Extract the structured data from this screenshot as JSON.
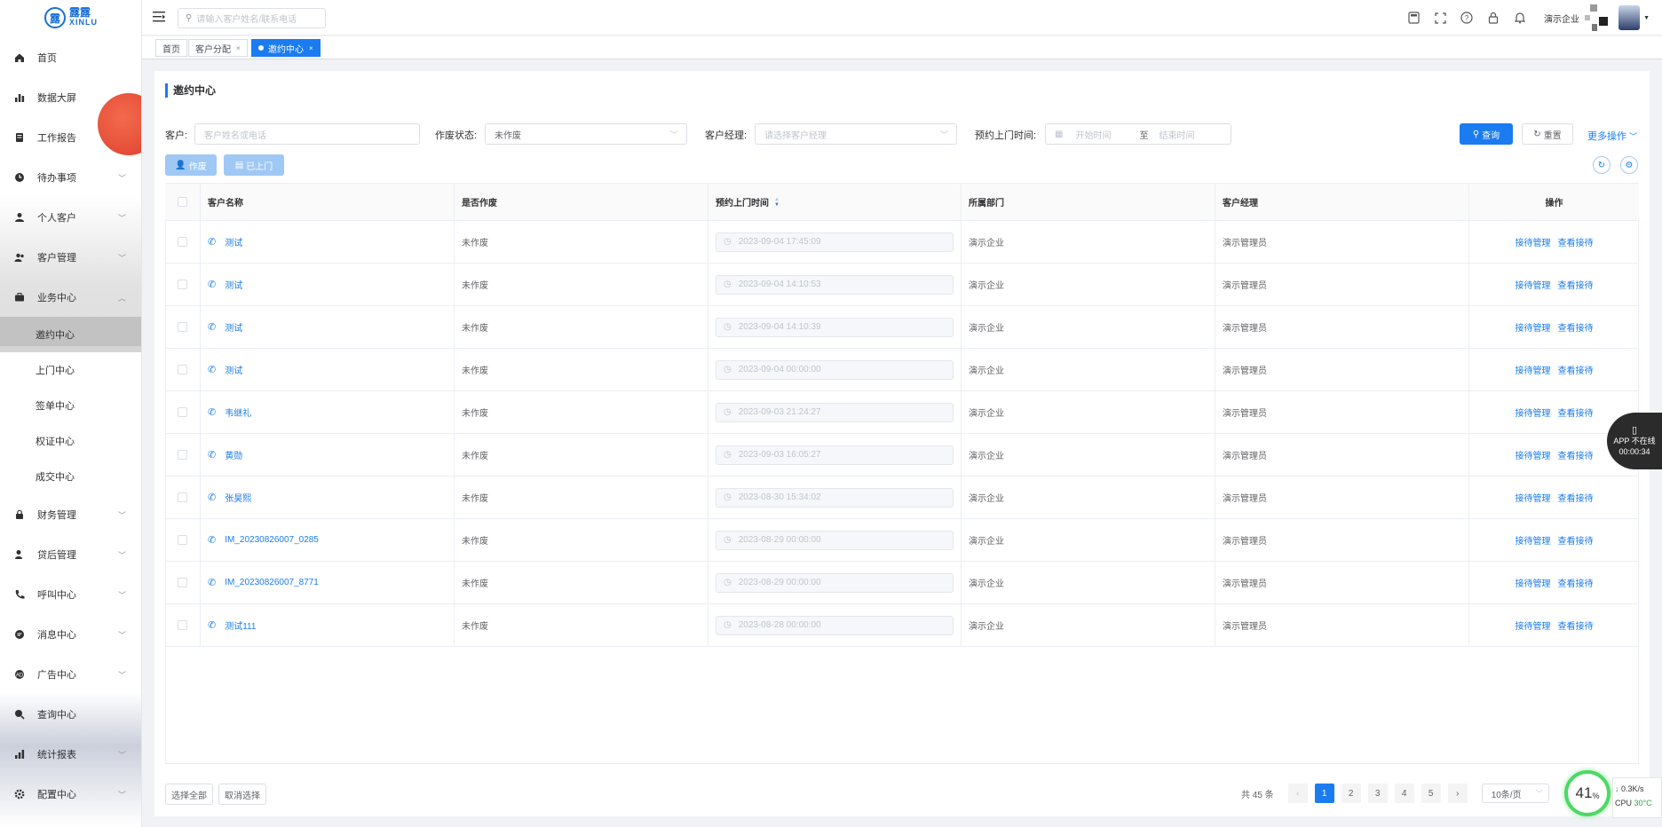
{
  "logo": {
    "mark": "露",
    "name": "露露",
    "sub": "XINLU"
  },
  "topbar": {
    "search_placeholder": "请输入客户姓名/联系电话",
    "company": "演示企业"
  },
  "sidebar": {
    "items": [
      {
        "label": "首页",
        "icon": "home-icon"
      },
      {
        "label": "数据大屏",
        "icon": "bar-chart-icon"
      },
      {
        "label": "工作报告",
        "icon": "document-icon"
      },
      {
        "label": "待办事项",
        "icon": "clock-icon"
      },
      {
        "label": "个人客户",
        "icon": "user-icon"
      },
      {
        "label": "客户管理",
        "icon": "users-icon"
      },
      {
        "label": "业务中心",
        "icon": "briefcase-icon"
      }
    ],
    "sub_items": [
      "邀约中心",
      "上门中心",
      "签单中心",
      "权证中心",
      "成交中心"
    ],
    "items2": [
      {
        "label": "财务管理",
        "icon": "lock-icon"
      },
      {
        "label": "贷后管理",
        "icon": "user-key-icon"
      },
      {
        "label": "呼叫中心",
        "icon": "phone-icon"
      },
      {
        "label": "消息中心",
        "icon": "message-icon"
      },
      {
        "label": "广告中心",
        "icon": "ad-icon"
      },
      {
        "label": "查询中心",
        "icon": "search-icon"
      },
      {
        "label": "统计报表",
        "icon": "stats-icon"
      },
      {
        "label": "配置中心",
        "icon": "gear-icon"
      }
    ]
  },
  "tabs": [
    {
      "label": "首页",
      "closable": false
    },
    {
      "label": "客户分配",
      "closable": true
    },
    {
      "label": "邀约中心",
      "closable": true,
      "active": true
    }
  ],
  "page": {
    "title": "邀约中心",
    "filters": {
      "customer_label": "客户:",
      "customer_placeholder": "客户姓名或电话",
      "status_label": "作废状态:",
      "status_value": "未作废",
      "manager_label": "客户经理:",
      "manager_placeholder": "请选择客户经理",
      "visit_label": "预约上门时间:",
      "start_placeholder": "开始时间",
      "range_sep": "至",
      "end_placeholder": "结束时间"
    },
    "buttons": {
      "query": "查询",
      "reset": "重置",
      "more": "更多操作",
      "void": "作废",
      "visited": "已上门"
    },
    "columns": [
      "客户名称",
      "是否作废",
      "预约上门时间",
      "所属部门",
      "客户经理",
      "操作"
    ],
    "rows": [
      {
        "name": "测试",
        "void": "未作废",
        "time": "2023-09-04 17:45:09",
        "dept": "演示企业",
        "manager": "演示管理员"
      },
      {
        "name": "测试",
        "void": "未作废",
        "time": "2023-09-04 14:10:53",
        "dept": "演示企业",
        "manager": "演示管理员"
      },
      {
        "name": "测试",
        "void": "未作废",
        "time": "2023-09-04 14:10:39",
        "dept": "演示企业",
        "manager": "演示管理员"
      },
      {
        "name": "测试",
        "void": "未作废",
        "time": "2023-09-04 00:00:00",
        "dept": "演示企业",
        "manager": "演示管理员"
      },
      {
        "name": "韦继礼",
        "void": "未作废",
        "time": "2023-09-03 21:24:27",
        "dept": "演示企业",
        "manager": "演示管理员"
      },
      {
        "name": "黄勋",
        "void": "未作废",
        "time": "2023-09-03 16:05:27",
        "dept": "演示企业",
        "manager": "演示管理员"
      },
      {
        "name": "张昊熙",
        "void": "未作废",
        "time": "2023-08-30 15:34:02",
        "dept": "演示企业",
        "manager": "演示管理员"
      },
      {
        "name": "IM_20230826007_0285",
        "void": "未作废",
        "time": "2023-08-29 00:00:00",
        "dept": "演示企业",
        "manager": "演示管理员"
      },
      {
        "name": "IM_20230826007_8771",
        "void": "未作废",
        "time": "2023-08-29 00:00:00",
        "dept": "演示企业",
        "manager": "演示管理员"
      },
      {
        "name": "测试111",
        "void": "未作废",
        "time": "2023-08-28 00:00:00",
        "dept": "演示企业",
        "manager": "演示管理员"
      }
    ],
    "row_ops": [
      "接待管理",
      "查看接待"
    ],
    "bottom": {
      "select_all": "选择全部",
      "cancel_select": "取消选择"
    },
    "pagination": {
      "total": "共 45 条",
      "pages": [
        "1",
        "2",
        "3",
        "4",
        "5"
      ],
      "current": "1",
      "page_size": "10条/页"
    }
  },
  "floating": {
    "app_status": "APP 不在线",
    "app_timer": "00:00:34",
    "gauge": "41",
    "gauge_unit": "%",
    "net_speed": "0.3K/s",
    "cpu_label": "CPU",
    "cpu_temp": "30°C"
  },
  "colors": {
    "accent": "#1a7cf0",
    "sidebar_active": "#a0a0a0"
  }
}
